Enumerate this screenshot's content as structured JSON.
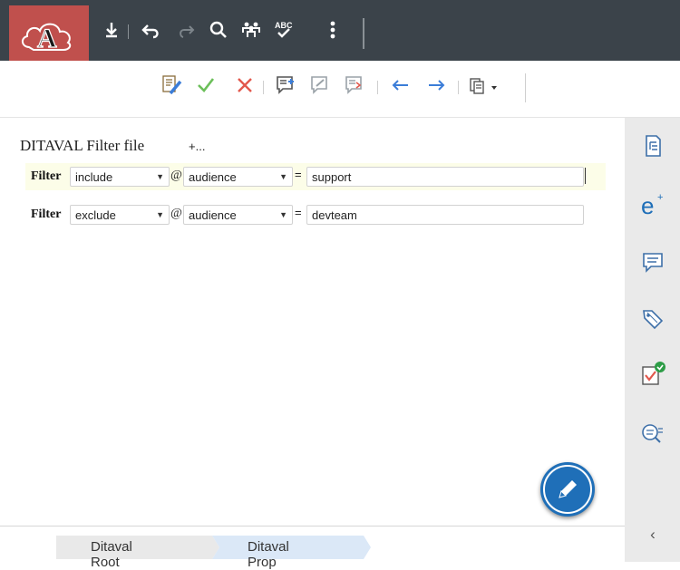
{
  "toolbar": {
    "logo": "app-logo",
    "icons": [
      "download-icon",
      "undo-icon",
      "redo-icon",
      "search-icon",
      "team-icon",
      "spellcheck-icon",
      "more-vertical-icon"
    ]
  },
  "review_toolbar": {
    "icons": [
      "track-changes-icon",
      "accept-change-icon",
      "reject-change-icon",
      "add-comment-icon",
      "edit-comment-icon",
      "reply-comment-icon",
      "previous-change-icon",
      "next-change-icon",
      "copy-menu-icon"
    ]
  },
  "editor": {
    "title": "DITAVAL Filter file",
    "add_label": "+...",
    "filters": [
      {
        "label": "Filter",
        "action": "include",
        "at": "@",
        "attribute": "audience",
        "eq": "=",
        "value": "support"
      },
      {
        "label": "Filter",
        "action": "exclude",
        "at": "@",
        "attribute": "audience",
        "eq": "=",
        "value": "devteam"
      }
    ]
  },
  "sidebar": {
    "icons": [
      "outline-icon",
      "elements-icon",
      "comments-icon",
      "tags-icon",
      "review-check-icon",
      "find-icon",
      "collapse-icon"
    ],
    "collapse_label": "‹"
  },
  "breadcrumb": {
    "items": [
      "Ditaval Root",
      "Ditaval Prop"
    ]
  },
  "colors": {
    "topbar": "#3b434a",
    "logo_bg": "#c0504d",
    "accent_blue": "#1f6fb8",
    "active_row": "#fcfde8",
    "accept_green": "#6cbf5a",
    "reject_red": "#e2574c"
  }
}
